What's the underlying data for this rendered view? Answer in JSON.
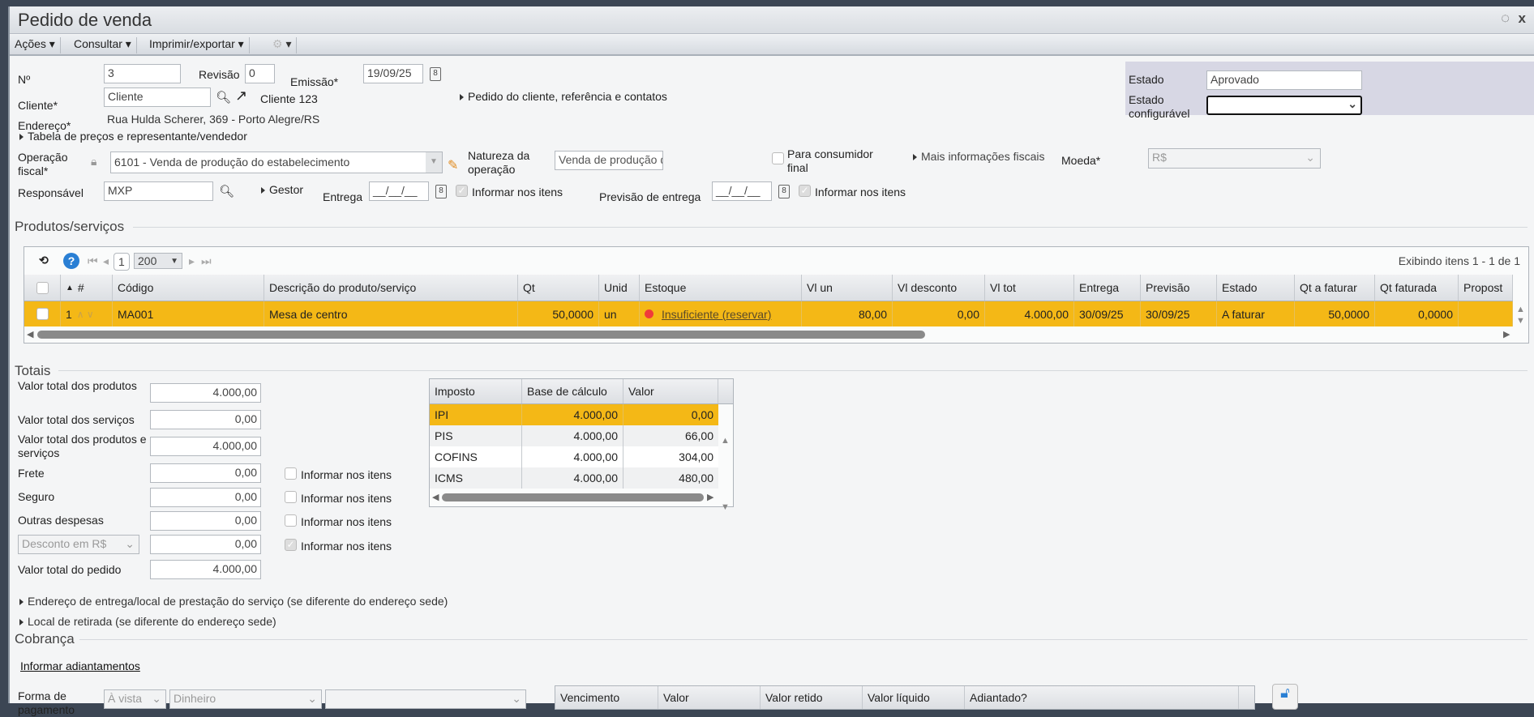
{
  "window": {
    "title": "Pedido de venda"
  },
  "toolbar": {
    "acoes": "Ações",
    "consultar": "Consultar",
    "imprimir": "Imprimir/exportar"
  },
  "form": {
    "numero_label": "Nº",
    "numero": "3",
    "revisao_label": "Revisão",
    "revisao": "0",
    "emissao_label": "Emissão*",
    "emissao": "19/09/25",
    "cliente_label": "Cliente*",
    "cliente": "Cliente",
    "cliente_nome": "Cliente 123",
    "pedido_cliente_link": "Pedido do cliente, referência e contatos",
    "endereco_label": "Endereço*",
    "endereco": "Rua Hulda Scherer, 369 - Porto Alegre/RS",
    "tabela_precos_link": "Tabela de preços e representante/vendedor",
    "operacao_label": "Operação fiscal*",
    "operacao": "6101 - Venda de produção do estabelecimento",
    "natureza_label": "Natureza da operação",
    "natureza": "Venda de produção do estabelecime",
    "consumidor_final_label": "Para consumidor final",
    "mais_info_link": "Mais informações fiscais",
    "moeda_label": "Moeda*",
    "moeda": "R$",
    "responsavel_label": "Responsável",
    "responsavel": "MXP",
    "gestor_link": "Gestor",
    "entrega_label": "Entrega",
    "entrega": "__/__/__",
    "informar_itens": "Informar nos itens",
    "previsao_label": "Previsão de entrega",
    "previsao": "__/__/__"
  },
  "estado": {
    "label": "Estado",
    "value": "Aprovado",
    "config_label": "Estado configurável",
    "config_value": ""
  },
  "produtos": {
    "section": "Produtos/serviços",
    "page": "1",
    "page_size": "200",
    "showing": "Exibindo itens 1 - 1 de 1",
    "columns": [
      "#",
      "Código",
      "Descrição do produto/serviço",
      "Qt",
      "Unid",
      "Estoque",
      "Vl un",
      "Vl desconto",
      "Vl tot",
      "Entrega",
      "Previsão",
      "Estado",
      "Qt a faturar",
      "Qt faturada",
      "Propost"
    ],
    "rows": [
      {
        "n": "1",
        "codigo": "MA001",
        "descricao": "Mesa de centro",
        "qt": "50,0000",
        "unid": "un",
        "estoque": "Insuficiente (reservar)",
        "vl_un": "80,00",
        "vl_desc": "0,00",
        "vl_tot": "4.000,00",
        "entrega": "30/09/25",
        "previsao": "30/09/25",
        "estado": "A faturar",
        "qt_faturar": "50,0000",
        "qt_faturada": "0,0000",
        "proposta": ""
      }
    ]
  },
  "totais": {
    "section": "Totais",
    "produtos_label": "Valor total dos produtos",
    "produtos": "4.000,00",
    "servicos_label": "Valor total dos serviços",
    "servicos": "0,00",
    "ps_label": "Valor total dos produtos e serviços",
    "ps": "4.000,00",
    "frete_label": "Frete",
    "frete": "0,00",
    "seguro_label": "Seguro",
    "seguro": "0,00",
    "outras_label": "Outras despesas",
    "outras": "0,00",
    "desconto_tipo": "Desconto em R$",
    "desconto": "0,00",
    "pedido_label": "Valor total do pedido",
    "pedido": "4.000,00",
    "informar_itens": "Informar nos itens"
  },
  "impostos": {
    "columns": [
      "Imposto",
      "Base de cálculo",
      "Valor"
    ],
    "rows": [
      {
        "nome": "IPI",
        "base": "4.000,00",
        "valor": "0,00"
      },
      {
        "nome": "PIS",
        "base": "4.000,00",
        "valor": "66,00"
      },
      {
        "nome": "COFINS",
        "base": "4.000,00",
        "valor": "304,00"
      },
      {
        "nome": "ICMS",
        "base": "4.000,00",
        "valor": "480,00"
      }
    ]
  },
  "links": {
    "endereco_entrega": "Endereço de entrega/local de prestação do serviço (se diferente do endereço sede)",
    "local_retirada": "Local de retirada (se diferente do endereço sede)"
  },
  "cobranca": {
    "section": "Cobrança",
    "adiantamentos": "Informar adiantamentos",
    "forma_label": "Forma de pagamento",
    "condicao": "À vista",
    "meio": "Dinheiro",
    "extra": "",
    "columns": [
      "Vencimento",
      "Valor",
      "Valor retido",
      "Valor líquido",
      "Adiantado?"
    ]
  },
  "colors": {
    "selected": "#f4b816",
    "accent": "#2a7fd4"
  }
}
